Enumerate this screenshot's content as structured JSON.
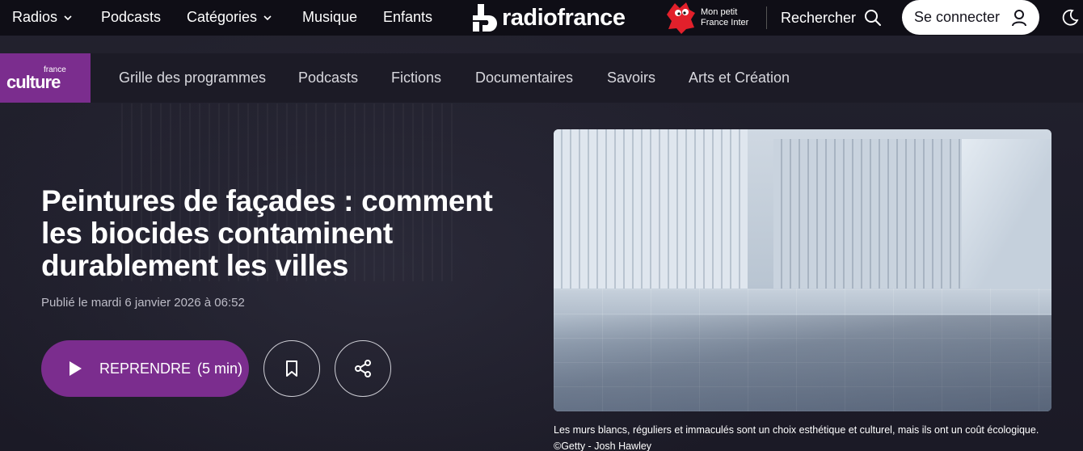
{
  "topnav": {
    "items": [
      {
        "label": "Radios",
        "has_dropdown": true
      },
      {
        "label": "Podcasts",
        "has_dropdown": false
      },
      {
        "label": "Catégories",
        "has_dropdown": true
      },
      {
        "label": "Musique",
        "has_dropdown": false
      },
      {
        "label": "Enfants",
        "has_dropdown": false
      }
    ],
    "brand": "radiofrance",
    "kids_brand": {
      "line1": "Mon petit",
      "line2": "France Inter"
    },
    "search_label": "Rechercher",
    "connect_label": "Se connecter"
  },
  "subnav": {
    "logo": {
      "small": "france",
      "big": "culture"
    },
    "items": [
      {
        "label": "Grille des programmes"
      },
      {
        "label": "Podcasts"
      },
      {
        "label": "Fictions"
      },
      {
        "label": "Documentaires"
      },
      {
        "label": "Savoirs"
      },
      {
        "label": "Arts et Création"
      }
    ]
  },
  "article": {
    "title": "Peintures de façades : comment les biocides contaminent durablement les villes",
    "published": "Publié le mardi 6 janvier 2026 à 06:52",
    "play": {
      "label": "REPRENDRE",
      "duration": "(5 min)"
    },
    "caption_text": "Les murs blancs, réguliers et immaculés sont un choix esthétique et culturel, mais ils ont un coût écologique.",
    "caption_credit": "©Getty - Josh Hawley"
  },
  "colors": {
    "accent": "#7b2d8e",
    "background": "#1d1c28",
    "topbar": "#0f0e16"
  }
}
